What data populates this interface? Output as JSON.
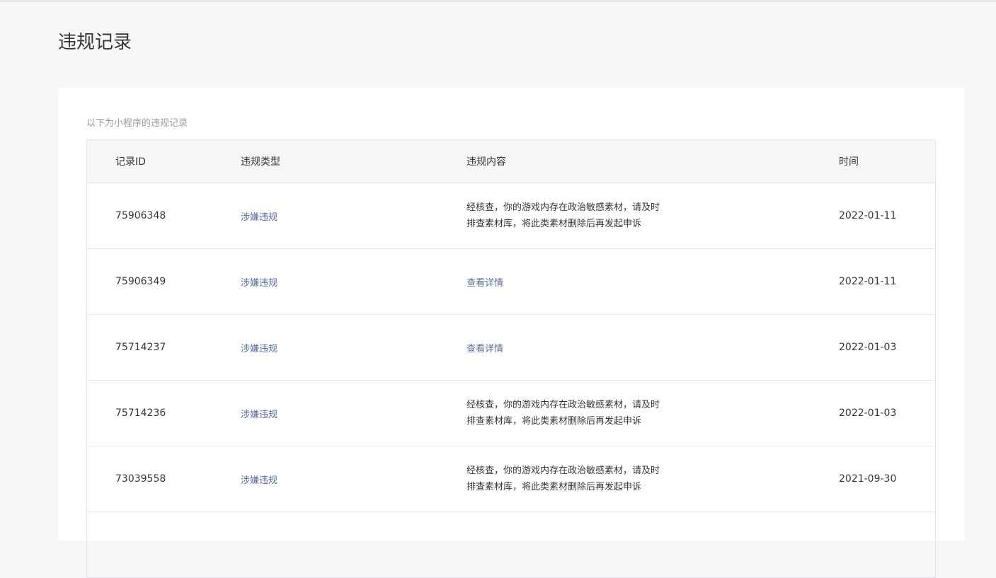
{
  "page": {
    "title": "违规记录",
    "description": "以下为小程序的违规记录"
  },
  "table": {
    "headers": {
      "id": "记录ID",
      "type": "违规类型",
      "content": "违规内容",
      "time": "时间"
    },
    "rows": [
      {
        "id": "75906348",
        "type": "涉嫌违规",
        "content_line1": "经核查，你的游戏内存在政治敏感素材，请及时",
        "content_line2": "排查素材库，将此类素材删除后再发起申诉",
        "link": "",
        "time": "2022-01-11"
      },
      {
        "id": "75906349",
        "type": "涉嫌违规",
        "content_line1": "",
        "content_line2": "",
        "link": "查看详情",
        "time": "2022-01-11"
      },
      {
        "id": "75714237",
        "type": "涉嫌违规",
        "content_line1": "",
        "content_line2": "",
        "link": "查看详情",
        "time": "2022-01-03"
      },
      {
        "id": "75714236",
        "type": "涉嫌违规",
        "content_line1": "经核查，你的游戏内存在政治敏感素材，请及时",
        "content_line2": "排查素材库，将此类素材删除后再发起申诉",
        "link": "",
        "time": "2022-01-03"
      },
      {
        "id": "73039558",
        "type": "涉嫌违规",
        "content_line1": "经核查，你的游戏内存在政治敏感素材，请及时",
        "content_line2": "排查素材库，将此类素材删除后再发起申诉",
        "link": "",
        "time": "2021-09-30"
      }
    ]
  },
  "colors": {
    "link": "#576b95",
    "background": "#f6f7f9",
    "text": "#353535",
    "muted": "#9a9a9a"
  }
}
